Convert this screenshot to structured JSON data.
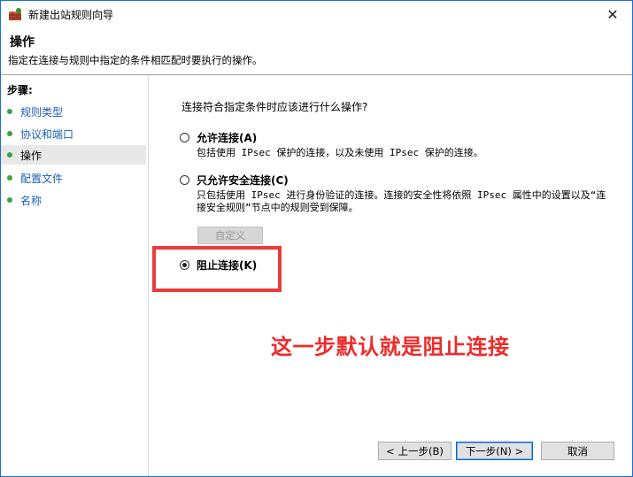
{
  "window": {
    "title": "新建出站规则向导",
    "close_symbol": "✕"
  },
  "header": {
    "title": "操作",
    "description": "指定在连接与规则中指定的条件相匹配时要执行的操作。"
  },
  "sidebar": {
    "steps_label": "步骤:",
    "items": [
      {
        "label": "规则类型"
      },
      {
        "label": "协议和端口"
      },
      {
        "label": "操作"
      },
      {
        "label": "配置文件"
      },
      {
        "label": "名称"
      }
    ],
    "active_index": 2,
    "dot_color": "#3aa33a"
  },
  "main": {
    "question": "连接符合指定条件时应该进行什么操作?",
    "options": [
      {
        "label": "允许连接(A)",
        "description": "包括使用 IPsec 保护的连接，以及未使用 IPsec 保护的连接。",
        "checked": false
      },
      {
        "label": "只允许安全连接(C)",
        "description": "只包括使用 IPsec 进行身份验证的连接。连接的安全性将依照 IPsec 属性中的设置以及“连接安全规则”节点中的规则受到保障。",
        "checked": false
      },
      {
        "label": "阻止连接(K)",
        "description": "",
        "checked": true
      }
    ],
    "customize_label": "自定义",
    "annotation": "这一步默认就是阻止连接",
    "annotation_color": "#ee2b2b"
  },
  "buttons": {
    "back": "< 上一步(B)",
    "next": "下一步(N) >",
    "cancel": "取消"
  }
}
